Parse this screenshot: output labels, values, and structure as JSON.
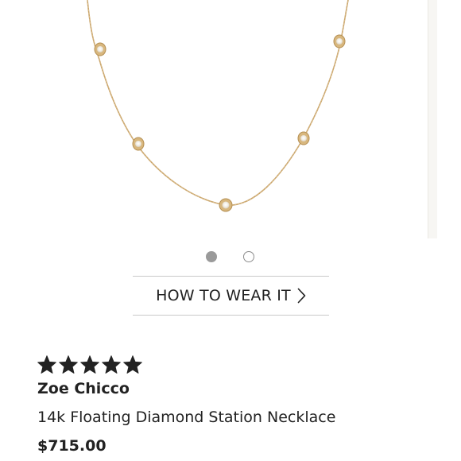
{
  "product_image": {
    "subject": "necklace-image"
  },
  "carousel": {
    "active_index": 0,
    "total": 2
  },
  "how_to_wear": {
    "label": "HOW TO WEAR IT",
    "icon": "chevron-right-icon"
  },
  "rating": {
    "stars": 5,
    "max": 5,
    "icon": "star-icon"
  },
  "product": {
    "brand": "Zoe Chicco",
    "name": "14k Floating Diamond Station Necklace",
    "price": "$715.00"
  },
  "colors": {
    "text": "#222222",
    "chain_gold": "#c9a46a",
    "dot_active": "#9a9a9a",
    "divider": "#c9c9c9"
  }
}
